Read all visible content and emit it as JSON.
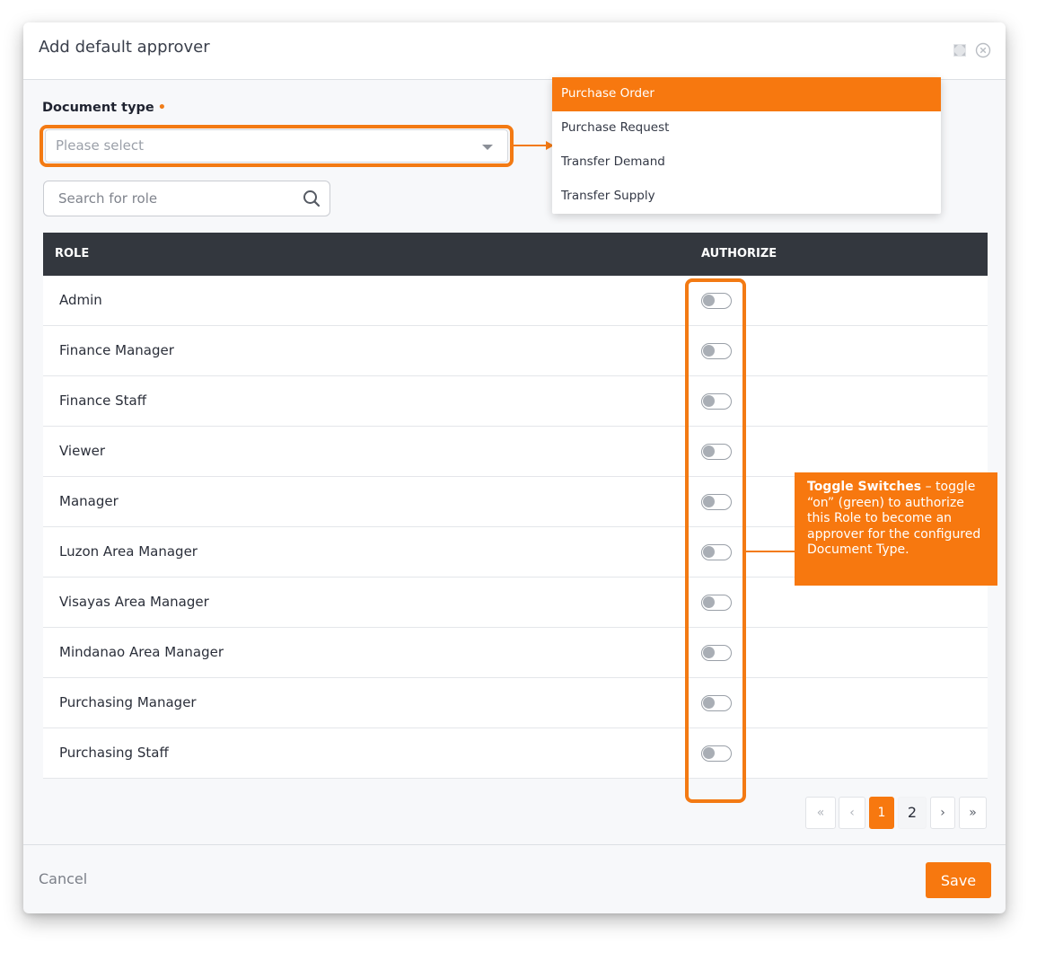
{
  "modal": {
    "title": "Add default approver",
    "icons": {
      "expand": "expand-icon",
      "close": "close-circle-icon"
    }
  },
  "document_type": {
    "label": "Document type",
    "required_marker": "•",
    "placeholder": "Please select",
    "options": [
      "Purchase Order",
      "Purchase Request",
      "Transfer Demand",
      "Transfer Supply"
    ],
    "highlighted_option": "Purchase Order"
  },
  "search": {
    "placeholder": "Search for role",
    "icon": "search-icon"
  },
  "table": {
    "headers": {
      "role": "ROLE",
      "authorize": "AUTHORIZE"
    },
    "rows": [
      {
        "role": "Admin",
        "authorized": false
      },
      {
        "role": "Finance Manager",
        "authorized": false
      },
      {
        "role": "Finance Staff",
        "authorized": false
      },
      {
        "role": "Viewer",
        "authorized": false
      },
      {
        "role": "Manager",
        "authorized": false
      },
      {
        "role": "Luzon Area Manager",
        "authorized": false
      },
      {
        "role": "Visayas Area Manager",
        "authorized": false
      },
      {
        "role": "Mindanao Area Manager",
        "authorized": false
      },
      {
        "role": "Purchasing Manager",
        "authorized": false
      },
      {
        "role": "Purchasing Staff",
        "authorized": false
      }
    ]
  },
  "callout": {
    "title": "Toggle Switches",
    "body": " – toggle “on” (green) to authorize this Role to become an approver for the configured Document Type."
  },
  "pagination": {
    "first": "«",
    "prev": "‹",
    "pages": [
      "1",
      "2"
    ],
    "current": "1",
    "next": "›",
    "last": "»"
  },
  "footer": {
    "cancel_label": "Cancel",
    "save_label": "Save"
  },
  "colors": {
    "accent": "#f7780f",
    "header_dark": "#33373e"
  }
}
